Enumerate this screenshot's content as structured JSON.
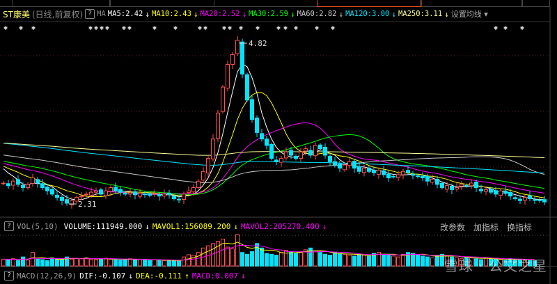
{
  "header": {
    "name": "ST康美",
    "period": "(日线,前复权)",
    "help": "?",
    "ma_label": "MA",
    "ma": [
      {
        "label": "MA5:2.42",
        "color": "#ffffff",
        "arrow": "↓"
      },
      {
        "label": "MA10:2.43",
        "color": "#ffff00",
        "arrow": "↓"
      },
      {
        "label": "MA20:2.52",
        "color": "#ff00ff",
        "arrow": "↓"
      },
      {
        "label": "MA30:2.59",
        "color": "#00ff00",
        "arrow": "↓"
      },
      {
        "label": "MA60:2.82",
        "color": "#c8c8c8",
        "arrow": "↓"
      },
      {
        "label": "MA120:3.00",
        "color": "#00e5ff",
        "arrow": "↓"
      },
      {
        "label": "MA250:3.11",
        "color": "#ffff99",
        "arrow": "↓"
      }
    ],
    "settings": "设置均线 ▾"
  },
  "vol_header": {
    "help": "?",
    "name": "VOL(5,10)",
    "volume": "VOLUME:111949.000",
    "mavol1": "MAVOL1:156089.200",
    "mavol2": "MAVOL2:205270.400",
    "arrow": "↓",
    "buttons": [
      "改参数",
      "加指标",
      "换指标"
    ]
  },
  "macd_header": {
    "help": "?",
    "name": "MACD(12,26,9)",
    "dif": "DIF:-0.107",
    "dif_arrow": "↓",
    "dea": "DEA:-0.111",
    "dea_arrow": "↑",
    "macd": "MACD:0.007",
    "macd_arrow": "↓"
  },
  "watermark": "雪球 · 公文之星",
  "chart_data": {
    "type": "candlestick",
    "ylim": [
      2.0,
      5.0
    ],
    "high_label": "4.82",
    "low_label": "2.31",
    "closes": [
      2.62,
      2.58,
      2.65,
      2.6,
      2.55,
      2.6,
      2.7,
      2.62,
      2.55,
      2.5,
      2.45,
      2.4,
      2.35,
      2.31,
      2.35,
      2.4,
      2.42,
      2.45,
      2.48,
      2.5,
      2.45,
      2.5,
      2.55,
      2.5,
      2.48,
      2.45,
      2.47,
      2.44,
      2.46,
      2.45,
      2.43,
      2.46,
      2.42,
      2.45,
      2.44,
      2.38,
      2.36,
      2.45,
      2.5,
      2.55,
      2.65,
      2.8,
      3.0,
      3.3,
      3.7,
      4.1,
      4.45,
      4.6,
      4.82,
      4.3,
      3.9,
      3.6,
      3.4,
      3.3,
      3.2,
      3.0,
      2.95,
      3.0,
      3.1,
      3.05,
      3.0,
      3.1,
      3.15,
      3.05,
      3.2,
      3.15,
      3.05,
      2.95,
      2.9,
      2.85,
      2.9,
      2.95,
      2.85,
      2.8,
      2.85,
      2.8,
      2.78,
      2.82,
      2.75,
      2.7,
      2.72,
      2.75,
      2.8,
      2.78,
      2.74,
      2.72,
      2.7,
      2.65,
      2.68,
      2.6,
      2.55,
      2.58,
      2.52,
      2.55,
      2.6,
      2.58,
      2.62,
      2.55,
      2.5,
      2.52,
      2.48,
      2.45,
      2.5,
      2.46,
      2.42,
      2.38,
      2.35,
      2.4,
      2.38,
      2.36,
      2.35,
      2.33
    ],
    "volumes": [
      150,
      140,
      160,
      120,
      200,
      130,
      300,
      150,
      140,
      120,
      180,
      160,
      140,
      200,
      150,
      170,
      160,
      180,
      150,
      140,
      160,
      170,
      150,
      140,
      130,
      150,
      160,
      140,
      150,
      130,
      120,
      140,
      130,
      120,
      110,
      120,
      110,
      200,
      250,
      240,
      300,
      400,
      450,
      500,
      550,
      600,
      420,
      380,
      700,
      300,
      260,
      320,
      500,
      400,
      280,
      260,
      240,
      300,
      350,
      320,
      280,
      300,
      360,
      400,
      340,
      300,
      260,
      240,
      300,
      280,
      260,
      240,
      220,
      260,
      240,
      220,
      280,
      300,
      260,
      240,
      220,
      200,
      260,
      300,
      280,
      240,
      220,
      200,
      180,
      240,
      260,
      220,
      200,
      180,
      160,
      200,
      180,
      160,
      140,
      180,
      160,
      150,
      140,
      130,
      160,
      150,
      140,
      130,
      120,
      112
    ]
  }
}
